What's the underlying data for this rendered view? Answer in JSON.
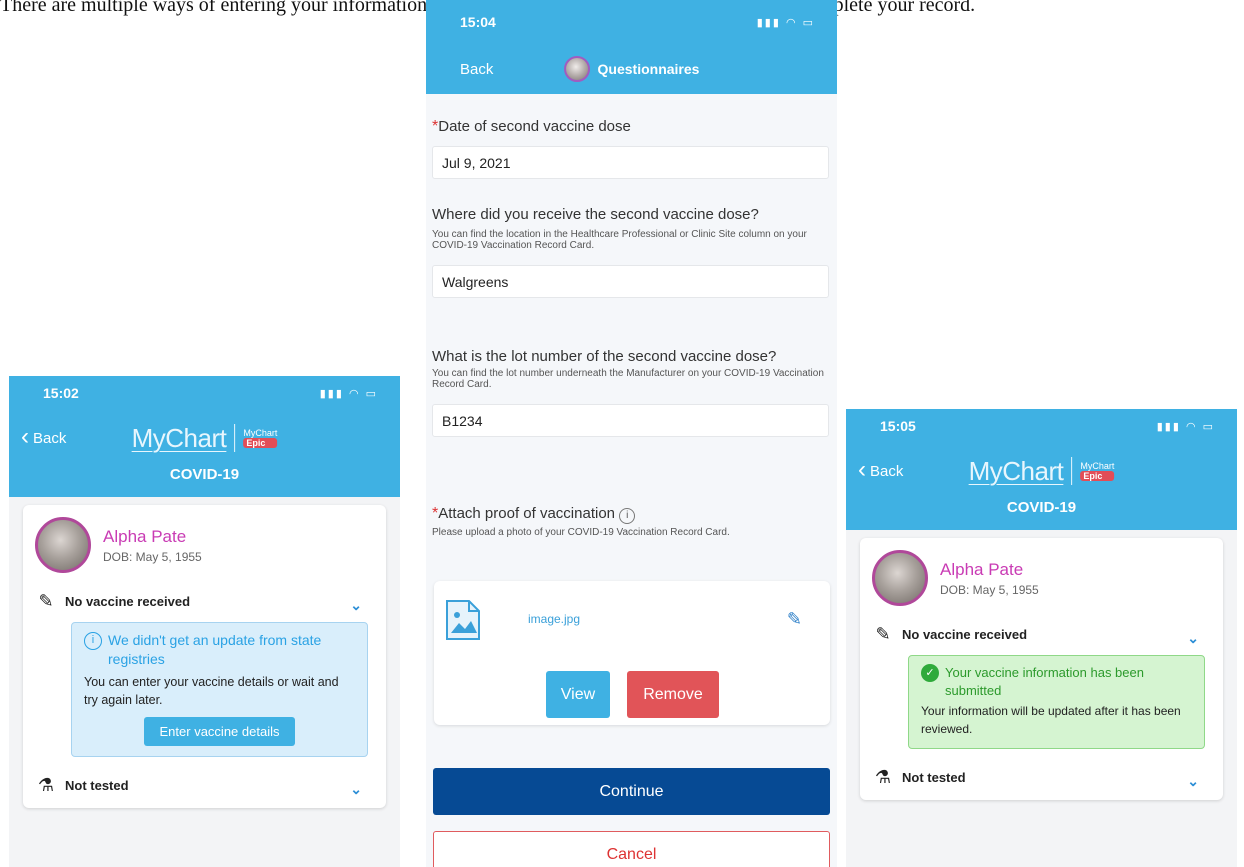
{
  "caption": "There are multiple ways of entering your information or attaching an image of your vaccine card to complete your record.",
  "left_screen": {
    "time": "15:02",
    "status_icons": "▮▮▮ ◠ ▭",
    "back": "Back",
    "brand": "MyChart",
    "brand_by": "MyChart",
    "brand_epic": "Epic",
    "title": "COVID-19",
    "patient_name": "Alpha Pate",
    "patient_dob": "DOB: May 5, 1955",
    "vaccine_status": "No vaccine received",
    "info_title": "We didn't get an update from state registries",
    "info_body": "You can enter your vaccine details or wait and try again later.",
    "enter_button": "Enter vaccine details",
    "test_status": "Not tested"
  },
  "middle_screen": {
    "time": "15:04",
    "status_icons": "▮▮▮ ◠ ▭",
    "back": "Back",
    "title": "Questionnaires",
    "q1_label": "Date of second vaccine dose",
    "q1_value": "Jul 9, 2021",
    "q2_label": "Where did you receive the second vaccine dose?",
    "q2_help": "You can find the location in the Healthcare Professional or Clinic Site column on your COVID-19 Vaccination Record Card.",
    "q2_value": "Walgreens",
    "q3_label": "What is the lot number of the second vaccine dose?",
    "q3_help": "You can find the lot number underneath the Manufacturer on your COVID-19 Vaccination Record Card.",
    "q3_value": "B1234",
    "q4_label": "Attach proof of vaccination",
    "q4_help": "Please upload a photo of your COVID-19 Vaccination Record Card.",
    "file_name": "image.jpg",
    "view_button": "View",
    "remove_button": "Remove",
    "continue_button": "Continue",
    "cancel_button": "Cancel"
  },
  "right_screen": {
    "time": "15:05",
    "status_icons": "▮▮▮ ◠ ▭",
    "back": "Back",
    "brand": "MyChart",
    "brand_by": "MyChart",
    "brand_epic": "Epic",
    "title": "COVID-19",
    "patient_name": "Alpha Pate",
    "patient_dob": "DOB: May 5, 1955",
    "vaccine_status": "No vaccine received",
    "success_title": "Your vaccine information has been submitted",
    "success_body": "Your information will be updated after it has been reviewed.",
    "test_status": "Not tested"
  },
  "colors": {
    "header_blue": "#3fb1e3",
    "continue_navy": "#064a94",
    "remove_red": "#e15458",
    "patient_magenta": "#c93bb4",
    "success_green": "#2faa3b"
  }
}
